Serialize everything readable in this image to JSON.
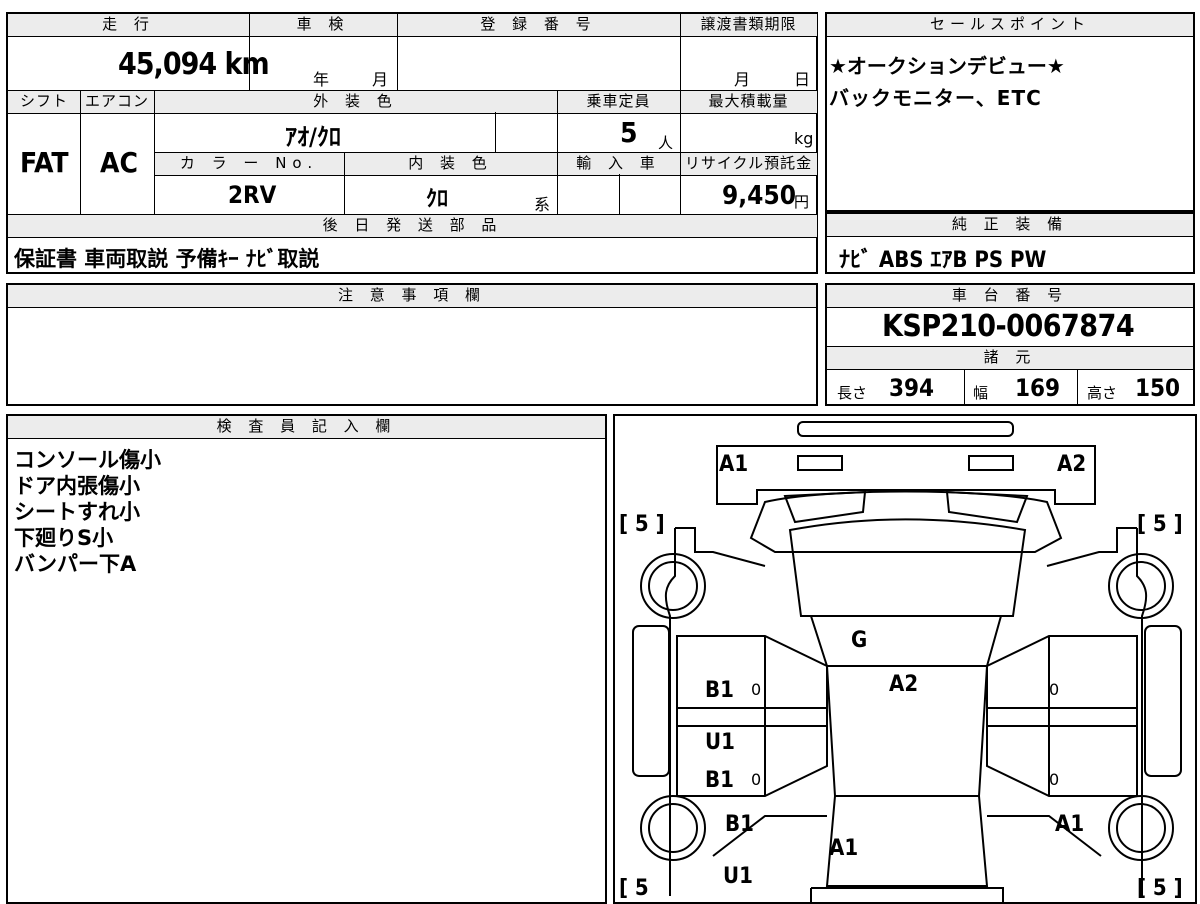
{
  "vehicle_box": {
    "mileage_label": "走 行",
    "mileage_value": "45,094 km",
    "inspection_label": "車 検",
    "inspection_year": "年",
    "inspection_month": "月",
    "registration_label": "登 録 番 号",
    "registration_value": "",
    "transfer_label": "譲渡書類期限",
    "transfer_month": "月",
    "transfer_day": "日",
    "shift_label": "シフト",
    "shift_value": "FAT",
    "ac_label": "エアコン",
    "ac_value": "AC",
    "exterior_color_label": "外 装 色",
    "exterior_color_value": "ｱｵ/ｸﾛ",
    "capacity_label": "乗車定員",
    "capacity_value": "5",
    "capacity_unit": "人",
    "max_load_label": "最大積載量",
    "max_load_unit": "kg",
    "color_no_label": "カ ラ ー No.",
    "color_no_value": "2RV",
    "interior_color_label": "内 装 色",
    "interior_color_value": "ｸﾛ",
    "interior_suffix": "系",
    "import_label": "輸 入 車",
    "recycle_label": "リサイクル預託金",
    "recycle_value": "9,450",
    "recycle_unit": "円",
    "later_parts_label": "後 日 発 送 部 品",
    "later_parts_value": "保証書 車両取説 予備ｷｰ ﾅﾋﾞ取説"
  },
  "sales_point": {
    "label": "セールスポイント",
    "line1": "★オークションデビュー★",
    "line2": "バックモニター、ETC"
  },
  "equipment": {
    "label": "純 正 装 備",
    "value": "ﾅﾋﾞ ABS ｴｱB PS PW"
  },
  "notes": {
    "label": "注 意 事 項 欄",
    "value": ""
  },
  "chassis": {
    "label": "車 台 番 号",
    "value": "KSP210-0067874",
    "spec_label": "諸 元",
    "length_label": "長さ",
    "length_value": "394",
    "width_label": "幅",
    "width_value": "169",
    "height_label": "高さ",
    "height_value": "150"
  },
  "inspector": {
    "label": "検 査 員 記 入 欄",
    "lines": [
      "コンソール傷小",
      "ドア内張傷小",
      "シートすれ小",
      "下廻りS小",
      "バンパー下A"
    ]
  },
  "diagram": {
    "marks": {
      "a1_front_left": "A1",
      "a2_front_right": "A2",
      "g_windshield": "G",
      "a2_roof": "A2",
      "b1_front_door_left": "B1",
      "u1_left": "U1",
      "b1_rear_door_left": "B1",
      "b1_rear_left": "B1",
      "a1_rear": "A1",
      "a1_rear_right": "A1",
      "u1_rear_left": "U1"
    },
    "tires": {
      "front_left": "[ 5 ]",
      "front_right": "[ 5 ]",
      "rear_left": "[ 5",
      "rear_right": "[ 5 ]"
    },
    "tread": [
      "0",
      "0",
      "0",
      "0"
    ]
  }
}
